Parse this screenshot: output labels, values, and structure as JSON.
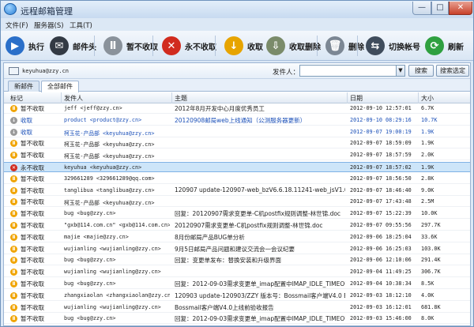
{
  "window": {
    "title": "远程邮箱管理"
  },
  "menu": [
    "文件(F)",
    "服务器(S)",
    "工具(T)"
  ],
  "toolbar": [
    {
      "label": "执行",
      "icon": "execute-icon",
      "color": "#2a6fc9",
      "glyph": "▶"
    },
    {
      "label": "邮件头",
      "icon": "news-icon",
      "color": "#333a44",
      "glyph": "✉"
    },
    {
      "label": "暂不收取",
      "icon": "pause-icon",
      "color": "#8a929b",
      "glyph": "Ⅱ"
    },
    {
      "label": "永不收取",
      "icon": "stop-icon",
      "color": "#d12b1e",
      "glyph": "✕"
    },
    {
      "label": "收取",
      "icon": "download-icon",
      "color": "#e7a400",
      "glyph": "↓"
    },
    {
      "label": "收取删除",
      "icon": "download-delete-icon",
      "color": "#7a8b6a",
      "glyph": "⇩"
    },
    {
      "label": "删除",
      "icon": "delete-icon",
      "color": "#7c8794",
      "glyph": "🗑"
    },
    {
      "label": "切换帐号",
      "icon": "switch-account-icon",
      "color": "#3f4c5c",
      "glyph": "⇆"
    },
    {
      "label": "刷新",
      "icon": "refresh-icon",
      "color": "#2fa040",
      "glyph": "⟳"
    }
  ],
  "account": "keyuhua@zzy.cn",
  "search": {
    "label": "发件人：",
    "value": "",
    "search_button": "搜索",
    "search_selected_button": "搜索选定"
  },
  "tabs": [
    "新邮件",
    "全部邮件"
  ],
  "columns": [
    "标记",
    "发件人",
    "主题",
    "日期",
    "大小"
  ],
  "status_colors": {
    "skip": "#f0a400",
    "download": "#9a9a9a",
    "never": "#d12b1e"
  },
  "rows": [
    {
      "mark": "暂不收取",
      "st": "skip",
      "sender": "jeff <jeff@zzy.cn>",
      "subject": "2012年8月开发中心月度优秀员工",
      "date": "2012-09-10 12:57:01",
      "size": "6.7K",
      "blue": false
    },
    {
      "mark": "收取",
      "st": "download",
      "sender": "product <product@zzy.cn>",
      "subject": "20120908邮局web上线通知（公测服务器更新）",
      "date": "2012-09-10 08:29:16",
      "size": "10.7K",
      "blue": true
    },
    {
      "mark": "收取",
      "st": "download",
      "sender": "柯玉花-产品部 <keyuhua@zzy.cn>",
      "subject": "",
      "date": "2012-09-07 19:00:19",
      "size": "1.9K",
      "blue": true
    },
    {
      "mark": "暂不收取",
      "st": "skip",
      "sender": "柯玉花-产品部 <keyuhua@zzy.cn>",
      "subject": "",
      "date": "2012-09-07 18:59:09",
      "size": "1.9K",
      "blue": false
    },
    {
      "mark": "暂不收取",
      "st": "skip",
      "sender": "柯玉花-产品部 <keyuhua@zzy.cn>",
      "subject": "",
      "date": "2012-09-07 18:57:59",
      "size": "2.0K",
      "blue": false
    },
    {
      "mark": "永不收取",
      "st": "never",
      "sender": "keyuhua <keyuhua@zzy.cn>",
      "subject": "",
      "date": "2012-09-07 18:57:02",
      "size": "1.9K",
      "blue": false,
      "selected": true
    },
    {
      "mark": "暂不收取",
      "st": "skip",
      "sender": "329661289 <329661289@qq.com>",
      "subject": "",
      "date": "2012-09-07 18:56:50",
      "size": "2.8K",
      "blue": false
    },
    {
      "mark": "暂不收取",
      "st": "skip",
      "sender": "tanglibua <tanglibua@zzy.cn>",
      "subject": "120907 update-120907-web_bzV6.6.18.11241-web_jsV1.0.7...",
      "date": "2012-09-07 18:46:40",
      "size": "9.0K",
      "blue": false
    },
    {
      "mark": "暂不收取",
      "st": "skip",
      "sender": "柯玉花-产品部 <keyuhua@zzy.cn>",
      "subject": "",
      "date": "2012-09-07 17:43:48",
      "size": "2.5M",
      "blue": false
    },
    {
      "mark": "暂不收取",
      "st": "skip",
      "sender": "bug <bug@zzy.cn>",
      "subject": "回复：20120907需求变更单-C机postfix规则调整-林世锦.doc",
      "date": "2012-09-07 15:22:39",
      "size": "10.0K",
      "blue": false
    },
    {
      "mark": "暂不收取",
      "st": "skip",
      "sender": "\"gxb@114.com.cn\" <gxb@114.com.cn>",
      "subject": "20120907需求变更单-C机postfix规则调整-林世锦.doc",
      "date": "2012-09-07 09:55:56",
      "size": "297.7K",
      "blue": false
    },
    {
      "mark": "暂不收取",
      "st": "skip",
      "sender": "majie <majie@zzy.cn>",
      "subject": "8月份邮局产品BUG单分析",
      "date": "2012-09-06 18:25:04",
      "size": "33.6K",
      "blue": false
    },
    {
      "mark": "暂不收取",
      "st": "skip",
      "sender": "wujianling <wujianling@zzy.cn>",
      "subject": "9月5日邮局产品问题和建议交流会一会议纪要",
      "date": "2012-09-06 16:25:03",
      "size": "103.0K",
      "blue": false
    },
    {
      "mark": "暂不收取",
      "st": "skip",
      "sender": "bug <bug@zzy.cn>",
      "subject": "回复：变更单发布：替换安装和升级界面",
      "date": "2012-09-06 12:10:06",
      "size": "291.4K",
      "blue": false
    },
    {
      "mark": "暂不收取",
      "st": "skip",
      "sender": "wujianling <wujianling@zzy.cn>",
      "subject": "",
      "date": "2012-09-04 11:49:25",
      "size": "306.7K",
      "blue": false
    },
    {
      "mark": "暂不收取",
      "st": "skip",
      "sender": "bug <bug@zzy.cn>",
      "subject": "回复：2012-09-03需求变更单_imap配置中IMAP_IDLE_TIMEOUT...",
      "date": "2012-09-04 10:38:34",
      "size": "8.5K",
      "blue": false
    },
    {
      "mark": "暂不收取",
      "st": "skip",
      "sender": "zhangxiaolan <zhangxiaolan@zzy.cn>",
      "subject": "120903 update-120903/ZZY 版本号：Bossmail客户端V4.0 B...",
      "date": "2012-09-03 18:12:10",
      "size": "4.0K",
      "blue": false
    },
    {
      "mark": "暂不收取",
      "st": "skip",
      "sender": "wujianling <wujianling@zzy.cn>",
      "subject": "Bossmail客户端V4.0上线前验收报告",
      "date": "2012-09-03 16:12:01",
      "size": "681.8K",
      "blue": false
    },
    {
      "mark": "暂不收取",
      "st": "skip",
      "sender": "bug <bug@zzy.cn>",
      "subject": "回复：2012-09-03需求变更单_imap配置中IMAP_IDLE_TIMEOUT...",
      "date": "2012-09-03 15:46:00",
      "size": "8.0K",
      "blue": false
    }
  ]
}
